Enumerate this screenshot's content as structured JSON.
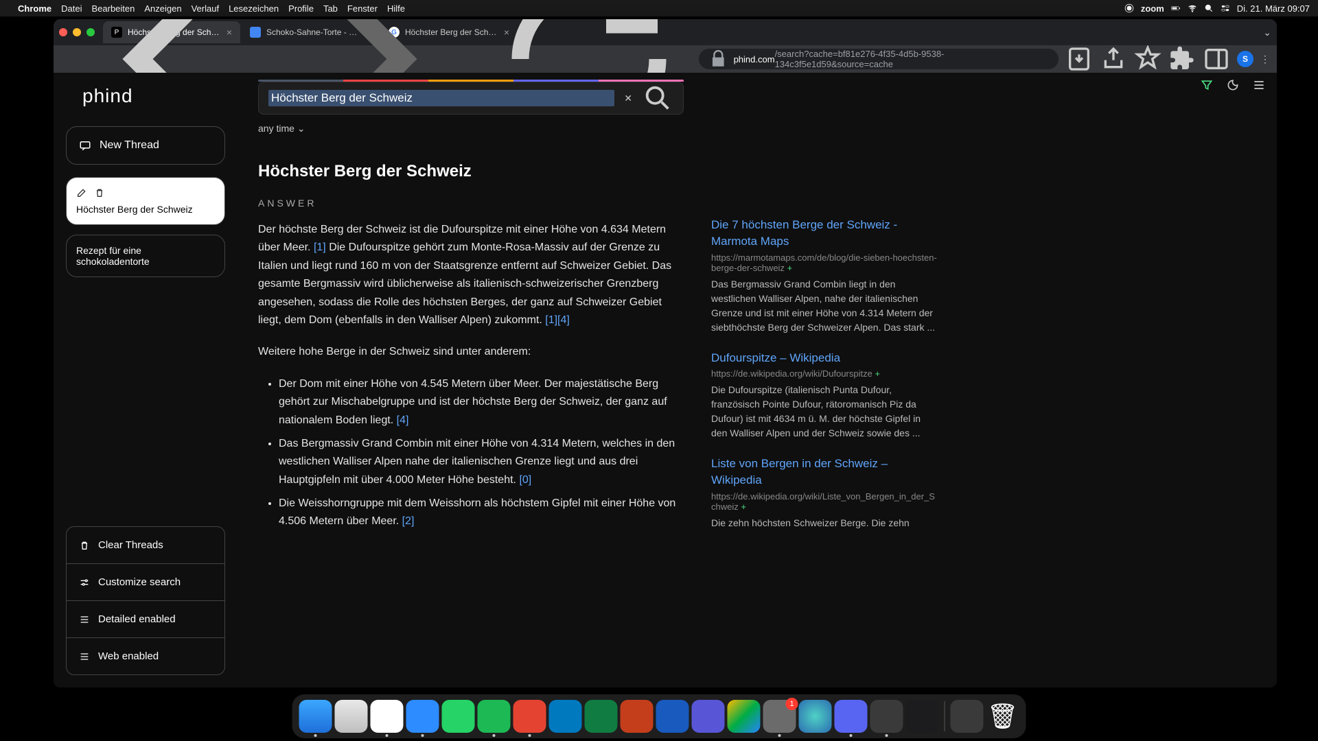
{
  "menubar": {
    "app": "Chrome",
    "items": [
      "Datei",
      "Bearbeiten",
      "Anzeigen",
      "Verlauf",
      "Lesezeichen",
      "Profile",
      "Tab",
      "Fenster",
      "Hilfe"
    ],
    "zoom": "zoom",
    "datetime": "Di. 21. März  09:07"
  },
  "tabs": [
    {
      "title": "Höchster Berg der Schweiz",
      "active": true,
      "favicon_bg": "#000"
    },
    {
      "title": "Schoko-Sahne-Torte - einfach",
      "active": false,
      "favicon_bg": "#4285f4"
    },
    {
      "title": "Höchster Berg der Schweiz - G",
      "active": false,
      "favicon_bg": "#fff"
    }
  ],
  "url": {
    "domain": "phind.com",
    "path": "/search?cache=bf81e276-4f35-4d5b-9538-134c3f5e1d59&source=cache"
  },
  "avatar_letter": "S",
  "sidebar": {
    "logo": "phind",
    "new_thread": "New Thread",
    "threads": [
      {
        "title": "Höchster Berg der Schweiz",
        "active": true
      },
      {
        "title": "Rezept für eine schokoladentorte",
        "active": false
      }
    ],
    "menu": {
      "clear": "Clear Threads",
      "customize": "Customize search",
      "detailed": "Detailed enabled",
      "web": "Web enabled"
    }
  },
  "search": {
    "query": "Höchster Berg der Schweiz",
    "time_filter": "any time",
    "rainbow": [
      "#4a5568",
      "#ef4444",
      "#f59e0b",
      "#6366f1",
      "#f472b6"
    ]
  },
  "answer": {
    "title": "Höchster Berg der Schweiz",
    "label": "ANSWER",
    "p1a": "Der höchste Berg der Schweiz ist die Dufourspitze mit einer Höhe von 4.634 Metern über Meer.",
    "c1": "[1]",
    "p1b": " Die Dufourspitze gehört zum Monte-Rosa-Massiv auf der Grenze zu Italien und liegt rund 160 m von der Staatsgrenze entfernt auf Schweizer Gebiet. Das gesamte Bergmassiv wird üblicherweise als italienisch-schweizerischer Grenzberg angesehen, sodass die Rolle des höchsten Berges, der ganz auf Schweizer Gebiet liegt, dem Dom (ebenfalls in den Walliser Alpen) zukommt. ",
    "c2": "[1]",
    "c3": "[4]",
    "p2": "Weitere hohe Berge in der Schweiz sind unter anderem:",
    "li1": "Der Dom mit einer Höhe von 4.545 Metern über Meer. Der majestätische Berg gehört zur Mischabelgruppe und ist der höchste Berg der Schweiz, der ganz auf nationalem Boden liegt. ",
    "li1c": "[4]",
    "li2": "Das Bergmassiv Grand Combin mit einer Höhe von 4.314 Metern, welches in den westlichen Walliser Alpen nahe der italienischen Grenze liegt und aus drei Hauptgipfeln mit über 4.000 Meter Höhe besteht. ",
    "li2c": "[0]",
    "li3": "Die Weisshorngruppe mit dem Weisshorn als höchstem Gipfel mit einer Höhe von 4.506 Metern über Meer. ",
    "li3c": "[2]"
  },
  "sources": [
    {
      "title": "Die 7 höchsten Berge der Schweiz - Marmota Maps",
      "url": "https://marmotamaps.com/de/blog/die-sieben-hoechsten-berge-der-schweiz",
      "desc": "Das Bergmassiv Grand Combin liegt in den westlichen Walliser Alpen, nahe der italienischen Grenze und ist mit einer Höhe von 4.314 Metern der siebthöchste Berg der Schweizer Alpen. Das stark ..."
    },
    {
      "title": "Dufourspitze – Wikipedia",
      "url": "https://de.wikipedia.org/wiki/Dufourspitze",
      "desc": "Die Dufourspitze (italienisch Punta Dufour, französisch Pointe Dufour, rätoromanisch Piz da Dufour) ist mit 4634 m ü. M. der höchste Gipfel in den Walliser Alpen und der Schweiz sowie des ..."
    },
    {
      "title": "Liste von Bergen in der Schweiz – Wikipedia",
      "url": "https://de.wikipedia.org/wiki/Liste_von_Bergen_in_der_Schweiz",
      "desc": "Die zehn höchsten Schweizer Berge. Die zehn"
    }
  ],
  "dock": {
    "badge": "1",
    "items": [
      {
        "name": "finder",
        "bg": "linear-gradient(#3ba7ff,#1e6fd9)"
      },
      {
        "name": "safari",
        "bg": "linear-gradient(#e8e8e8,#bfbfbf)"
      },
      {
        "name": "chrome",
        "bg": "#fff"
      },
      {
        "name": "zoom-app",
        "bg": "#2d8cff"
      },
      {
        "name": "whatsapp",
        "bg": "#25d366"
      },
      {
        "name": "spotify",
        "bg": "#1db954"
      },
      {
        "name": "todoist",
        "bg": "#e44332"
      },
      {
        "name": "trello",
        "bg": "#0079bf"
      },
      {
        "name": "excel",
        "bg": "#107c41"
      },
      {
        "name": "powerpoint",
        "bg": "#c43e1c"
      },
      {
        "name": "word",
        "bg": "#185abd"
      },
      {
        "name": "imovie",
        "bg": "#5856d6"
      },
      {
        "name": "drive",
        "bg": "linear-gradient(135deg,#ffba00,#00ac47 50%,#2684fc)"
      },
      {
        "name": "settings",
        "bg": "#6b6b6b"
      },
      {
        "name": "siri",
        "bg": "radial-gradient(circle,#4fd1c5,#2b6cb0)"
      },
      {
        "name": "discord",
        "bg": "#5865f2"
      },
      {
        "name": "quicktime",
        "bg": "#3a3a3a"
      },
      {
        "name": "voice-memos",
        "bg": "#1c1c1e"
      }
    ],
    "right_items": [
      {
        "name": "calculator",
        "bg": "#3a3a3a"
      },
      {
        "name": "trash",
        "bg": "transparent"
      }
    ]
  }
}
